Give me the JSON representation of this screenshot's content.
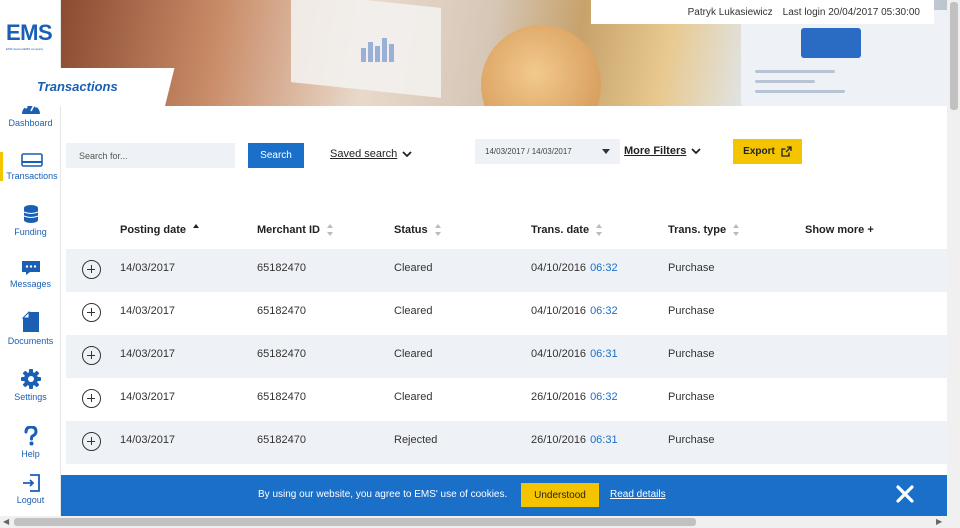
{
  "brand": {
    "logo": "EMS",
    "tagline": "EMS Secure/EMS company"
  },
  "sidebar": {
    "items": [
      {
        "label": "Dashboard",
        "icon": "dashboard-icon"
      },
      {
        "label": "Transactions",
        "icon": "card-icon",
        "active": true
      },
      {
        "label": "Funding",
        "icon": "coins-icon"
      },
      {
        "label": "Messages",
        "icon": "message-icon"
      },
      {
        "label": "Documents",
        "icon": "document-icon"
      },
      {
        "label": "Settings",
        "icon": "gear-icon"
      },
      {
        "label": "Help",
        "icon": "question-icon"
      },
      {
        "label": "Logout",
        "icon": "logout-icon"
      }
    ]
  },
  "header": {
    "page_title": "Transactions",
    "user_name": "Patryk Lukasiewicz",
    "last_login": "Last login 20/04/2017 05:30:00"
  },
  "toolbar": {
    "search_placeholder": "Search for...",
    "search_label": "Search",
    "saved_search_label": "Saved search",
    "date_range": "14/03/2017 / 14/03/2017",
    "more_filters_label": "More Filters",
    "export_label": "Export"
  },
  "table": {
    "columns": [
      "Posting date",
      "Merchant ID",
      "Status",
      "Trans. date",
      "Trans. type"
    ],
    "show_more_label": "Show more +",
    "rows": [
      {
        "posting_date": "14/03/2017",
        "merchant_id": "65182470",
        "status": "Cleared",
        "trans_date": "04/10/2016",
        "trans_time": "06:32",
        "trans_type": "Purchase"
      },
      {
        "posting_date": "14/03/2017",
        "merchant_id": "65182470",
        "status": "Cleared",
        "trans_date": "04/10/2016",
        "trans_time": "06:32",
        "trans_type": "Purchase"
      },
      {
        "posting_date": "14/03/2017",
        "merchant_id": "65182470",
        "status": "Cleared",
        "trans_date": "04/10/2016",
        "trans_time": "06:31",
        "trans_type": "Purchase"
      },
      {
        "posting_date": "14/03/2017",
        "merchant_id": "65182470",
        "status": "Cleared",
        "trans_date": "26/10/2016",
        "trans_time": "06:32",
        "trans_type": "Purchase"
      },
      {
        "posting_date": "14/03/2017",
        "merchant_id": "65182470",
        "status": "Rejected",
        "trans_date": "26/10/2016",
        "trans_time": "06:31",
        "trans_type": "Purchase"
      }
    ]
  },
  "cookie": {
    "text": "By using our website, you agree to EMS' use of cookies.",
    "accept_label": "Understood",
    "details_label": "Read details"
  },
  "colors": {
    "brand_blue": "#1a6fc9",
    "accent_yellow": "#f5c400",
    "row_alt": "#eef1f6"
  }
}
